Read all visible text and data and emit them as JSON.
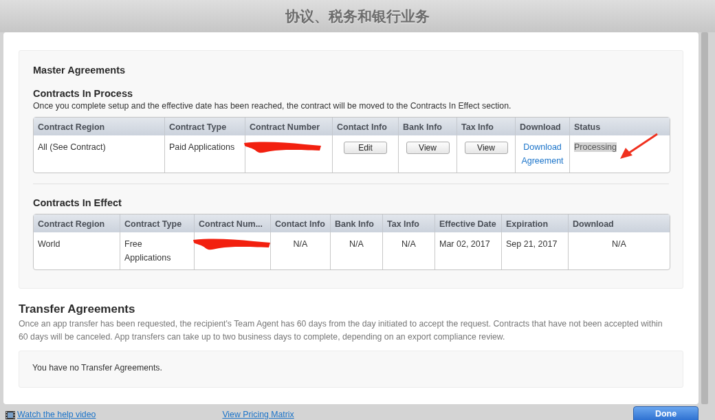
{
  "window": {
    "title": "协议、税务和银行业务"
  },
  "master": {
    "title": "Master Agreements"
  },
  "in_process": {
    "title": "Contracts In Process",
    "description": "Once you complete setup and the effective date has been reached, the contract will be moved to the Contracts In Effect section.",
    "columns": [
      "Contract Region",
      "Contract Type",
      "Contract Number",
      "Contact Info",
      "Bank Info",
      "Tax Info",
      "Download",
      "Status"
    ],
    "rows": [
      {
        "cells": [
          {
            "kind": "text",
            "text": "All (See Contract)"
          },
          {
            "kind": "text",
            "text": "Paid Applications"
          },
          {
            "kind": "redacted"
          },
          {
            "kind": "button",
            "text": "Edit"
          },
          {
            "kind": "button",
            "text": "View"
          },
          {
            "kind": "button",
            "text": "View"
          },
          {
            "kind": "link",
            "text": "Download Agreement"
          },
          {
            "kind": "text",
            "text": "Processing",
            "highlighted": true,
            "annotated": true
          }
        ]
      }
    ]
  },
  "in_effect": {
    "title": "Contracts In Effect",
    "columns": [
      "Contract Region",
      "Contract Type",
      "Contract Num...",
      "Contact Info",
      "Bank Info",
      "Tax Info",
      "Effective Date",
      "Expiration",
      "Download"
    ],
    "rows": [
      {
        "cells": [
          {
            "kind": "text",
            "text": "World"
          },
          {
            "kind": "text",
            "text": "Free Applications"
          },
          {
            "kind": "redacted"
          },
          {
            "kind": "center",
            "text": "N/A"
          },
          {
            "kind": "center",
            "text": "N/A"
          },
          {
            "kind": "center",
            "text": "N/A"
          },
          {
            "kind": "text",
            "text": "Mar 02, 2017"
          },
          {
            "kind": "text",
            "text": "Sep 21, 2017"
          },
          {
            "kind": "center",
            "text": "N/A"
          }
        ]
      }
    ]
  },
  "transfer": {
    "title": "Transfer Agreements",
    "description": "Once an app transfer has been requested, the recipient's Team Agent has 60 days from the day initiated to accept the request. Contracts that have not been accepted within 60 days will be canceled. App transfers can take up to two business days to complete, depending on an export compliance review.",
    "empty_message": "You have no Transfer Agreements."
  },
  "footer": {
    "help_link": "Watch the help video",
    "pricing_link": "View Pricing Matrix",
    "done_button": "Done"
  }
}
